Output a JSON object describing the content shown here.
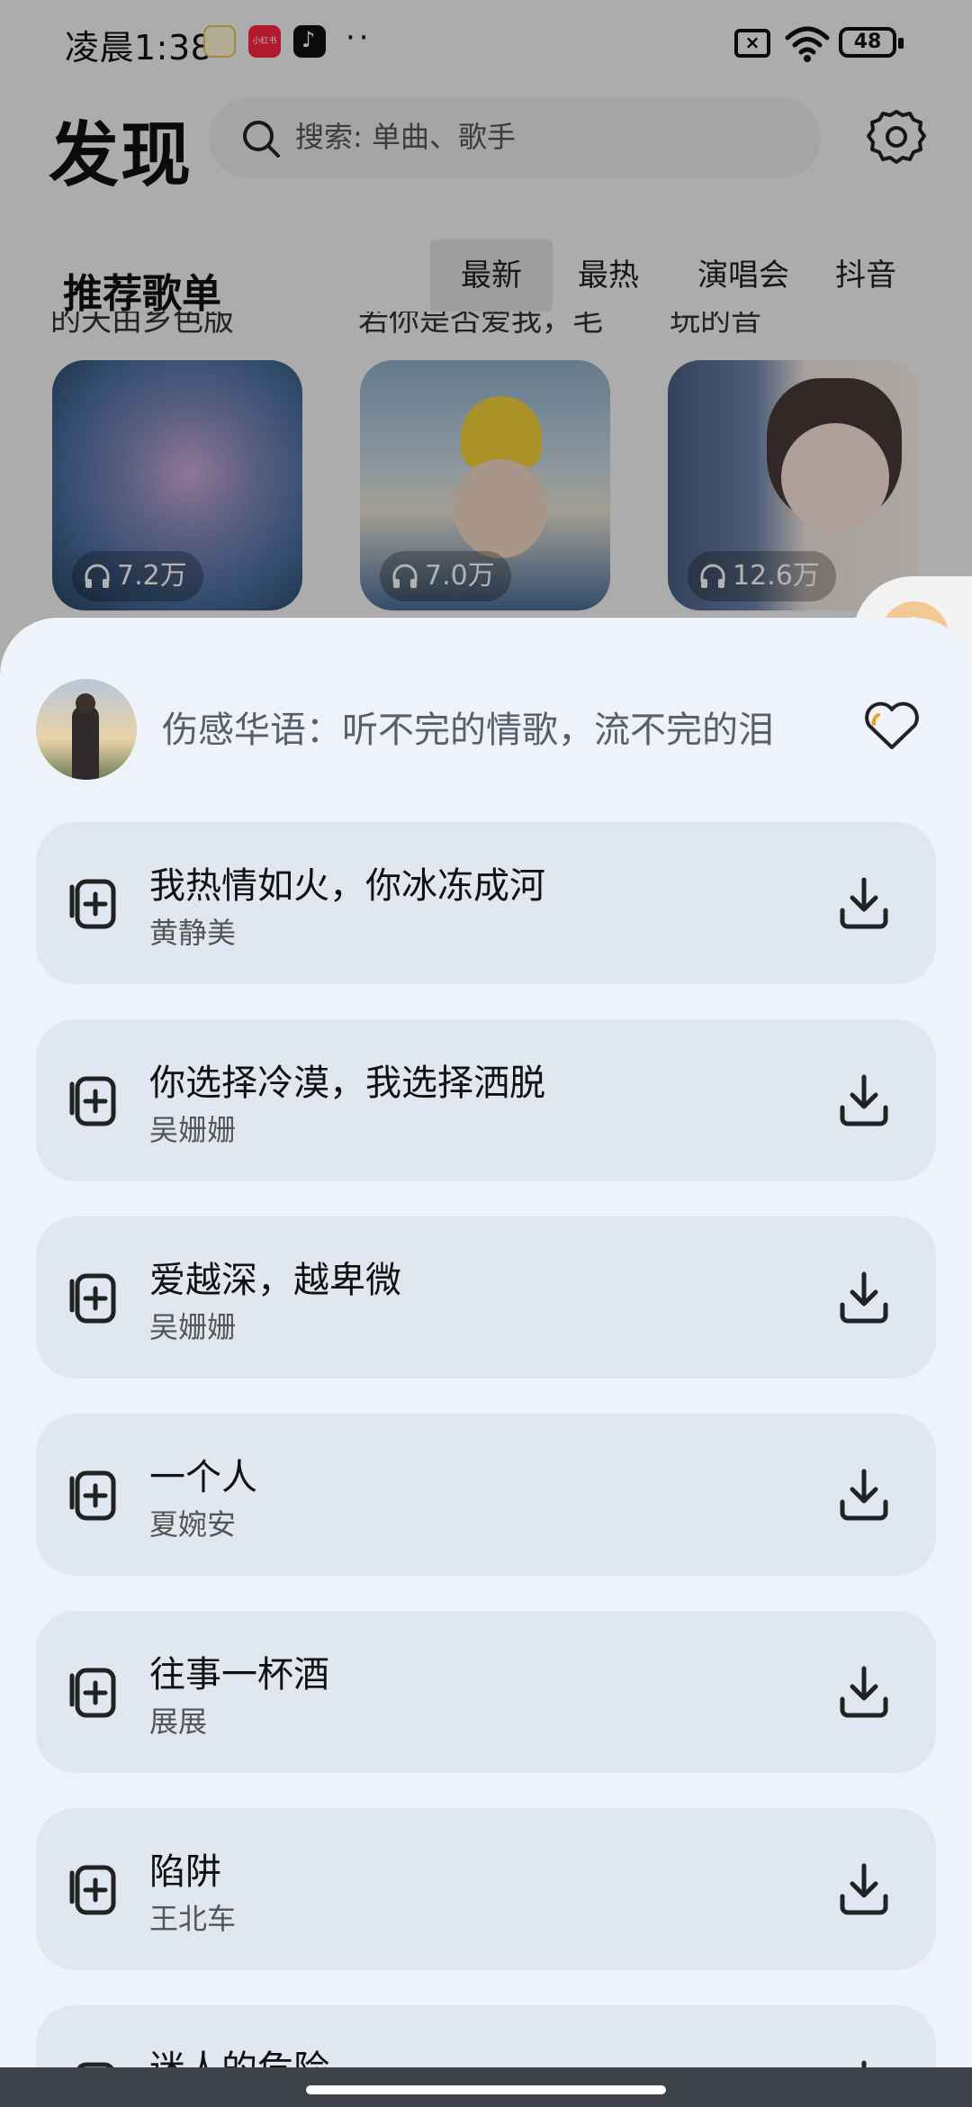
{
  "status_bar": {
    "time": "凌晨1:38",
    "app_xhs": "小红书",
    "more": "··",
    "battery": "48"
  },
  "header": {
    "title": "发现",
    "search_placeholder": "搜索: 单曲、歌手",
    "settings_icon": "settings-icon"
  },
  "section": {
    "title": "推荐歌单",
    "tabs": [
      "最新",
      "最热",
      "演唱会",
      "抖音"
    ],
    "active_tab": "最新",
    "cut_texts": [
      "的天由乡色版",
      "若你是否爱我，毛",
      "玩的音"
    ]
  },
  "playlists": [
    {
      "play_count": "7.2万"
    },
    {
      "play_count": "7.0万"
    },
    {
      "play_count": "12.6万"
    }
  ],
  "sheet": {
    "playlist_title": "伤感华语：听不完的情歌，流不完的泪",
    "songs": [
      {
        "title": "我热情如火，你冰冻成河",
        "artist": "黄静美"
      },
      {
        "title": "你选择冷漠，我选择洒脱",
        "artist": "吴姗姗"
      },
      {
        "title": "爱越深，越卑微",
        "artist": "吴姗姗"
      },
      {
        "title": "一个人",
        "artist": "夏婉安"
      },
      {
        "title": "往事一杯酒",
        "artist": "展展"
      },
      {
        "title": "陷阱",
        "artist": "王北车"
      },
      {
        "title": "迷人的危险",
        "artist": ""
      }
    ]
  },
  "colors": {
    "sheet_bg": "#eef3fb",
    "song_bg": "#e1e7f0",
    "accent_orange": "#f3c892"
  }
}
